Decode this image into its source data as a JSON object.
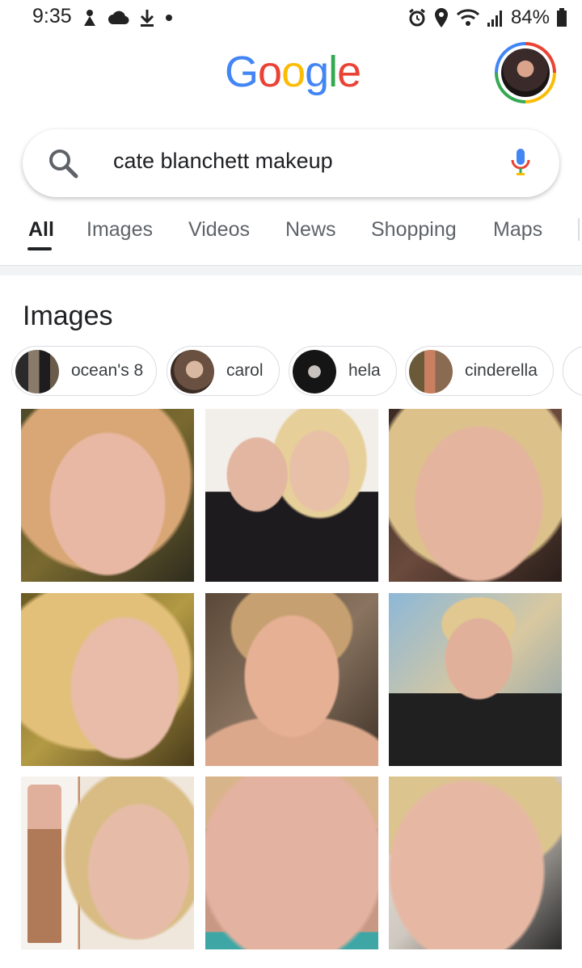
{
  "status": {
    "time": "9:35",
    "battery": "84%"
  },
  "google_logo": {
    "letters": [
      "G",
      "o",
      "o",
      "g",
      "l",
      "e"
    ],
    "colors": [
      "#4285F4",
      "#EA4335",
      "#FBBC05",
      "#4285F4",
      "#34A853",
      "#EA4335"
    ]
  },
  "search": {
    "query": "cate blanchett makeup"
  },
  "tabs": [
    "All",
    "Images",
    "Videos",
    "News",
    "Shopping",
    "Maps"
  ],
  "images_section": {
    "title": "Images",
    "chips": [
      "ocean's 8",
      "carol",
      "hela",
      "cinderella"
    ]
  },
  "colors": {
    "accent_blue": "#4285F4",
    "text_primary": "#202124",
    "text_secondary": "#5f6368"
  }
}
